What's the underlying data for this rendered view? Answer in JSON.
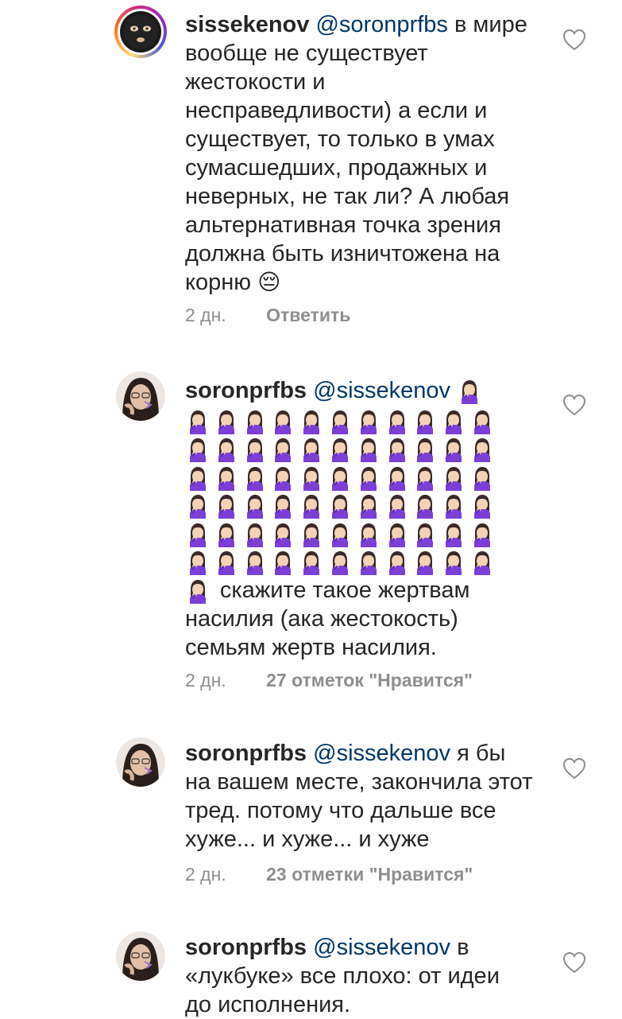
{
  "comments": [
    {
      "username": "sissekenov",
      "mention": "@soronprfbs",
      "text": "в мире вообще не существует жестокости и несправедливости) а если и существует, то только в умах сумасшедших, продажных и неверных, не так ли? А любая альтернативная точка зрения должна быть изничтожена на корню",
      "emoji": "😔",
      "age": "2 дн.",
      "action": "Ответить"
    },
    {
      "username": "soronprfbs",
      "mention": "@sissekenov",
      "emoji_name": "woman-facepalming",
      "text": "скажите такое жертвам насилия (ака жестокость) семьям жертв насилия.",
      "age": "2 дн.",
      "likes": "27 отметок \"Нравится\""
    },
    {
      "username": "soronprfbs",
      "mention": "@sissekenov",
      "text": "я бы на вашем месте, закончила этот тред. потому что дальше все хуже... и хуже... и хуже",
      "age": "2 дн.",
      "likes": "23 отметки \"Нравится\""
    },
    {
      "username": "soronprfbs",
      "mention": "@sissekenov",
      "text": "в «лукбуке» все плохо: от  идеи до исполнения."
    }
  ],
  "icons": {
    "like": "heart-outline-icon"
  },
  "colors": {
    "text": "#262626",
    "mention": "#00376b",
    "meta": "#8e8e8e"
  }
}
